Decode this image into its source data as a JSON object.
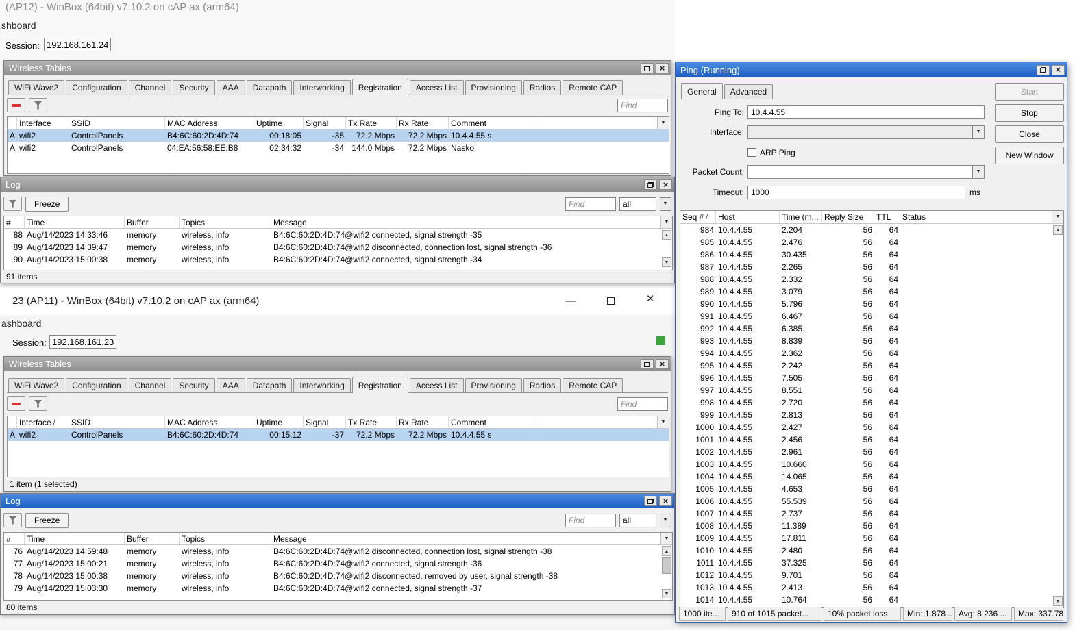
{
  "colors": {
    "titlebar_active": "#2e6fd0",
    "titlebar_inactive": "#9e9e9e",
    "selection": "#b7d3f0",
    "status_green": "#3aa53a",
    "remove_red": "#dd3333"
  },
  "shared": {
    "find_placeholder": "Find",
    "freeze_label": "Freeze",
    "filter_all": "all",
    "wt_title": "Wireless Tables",
    "log_title": "Log",
    "wt_tabs": [
      {
        "label": "WiFi Wave2"
      },
      {
        "label": "Configuration"
      },
      {
        "label": "Channel"
      },
      {
        "label": "Security"
      },
      {
        "label": "AAA"
      },
      {
        "label": "Datapath"
      },
      {
        "label": "Interworking"
      },
      {
        "label": "Registration",
        "sel": true
      },
      {
        "label": "Access List"
      },
      {
        "label": "Provisioning"
      },
      {
        "label": "Radios"
      },
      {
        "label": "Remote CAP"
      }
    ],
    "reg_columns": {
      "interface": "Interface",
      "ssid": "SSID",
      "mac": "MAC Address",
      "uptime": "Uptime",
      "signal": "Signal",
      "tx": "Tx Rate",
      "rx": "Rx Rate",
      "comment": "Comment"
    },
    "log_columns": {
      "num": "#",
      "time": "Time",
      "buffer": "Buffer",
      "topics": "Topics",
      "message": "Message"
    }
  },
  "ap12": {
    "window_title": "(AP12) - WinBox (64bit) v7.10.2 on cAP ax (arm64)",
    "dashboard_partial": "shboard",
    "session_label": "Session:",
    "session_value": "192.168.161.24",
    "reg_rows": [
      {
        "flag": "A",
        "iface": "wifi2",
        "ssid": "ControlPanels",
        "mac": "B4:6C:60:2D:4D:74",
        "uptime": "00:18:05",
        "signal": "-35",
        "tx": "72.2 Mbps",
        "rx": "72.2 Mbps",
        "comment": "10.4.4.55 s",
        "sel": true
      },
      {
        "flag": "A",
        "iface": "wifi2",
        "ssid": "ControlPanels",
        "mac": "04:EA:56:58:EE:B8",
        "uptime": "02:34:32",
        "signal": "-34",
        "tx": "144.0 Mbps",
        "rx": "72.2 Mbps",
        "comment": "Nasko"
      }
    ],
    "log_rows": [
      {
        "num": "88",
        "time": "Aug/14/2023 14:33:46",
        "buffer": "memory",
        "topics": "wireless, info",
        "message": "B4:6C:60:2D:4D:74@wifi2 connected, signal strength -35"
      },
      {
        "num": "89",
        "time": "Aug/14/2023 14:39:47",
        "buffer": "memory",
        "topics": "wireless, info",
        "message": "B4:6C:60:2D:4D:74@wifi2 disconnected, connection lost, signal strength -36"
      },
      {
        "num": "90",
        "time": "Aug/14/2023 15:00:38",
        "buffer": "memory",
        "topics": "wireless, info",
        "message": "B4:6C:60:2D:4D:74@wifi2 connected, signal strength -34"
      }
    ],
    "log_items_text": "91 items"
  },
  "ap11": {
    "window_title": "23 (AP11) - WinBox (64bit) v7.10.2 on cAP ax (arm64)",
    "dashboard_partial": "ashboard",
    "session_label": "Session:",
    "session_value": "192.168.161.23",
    "reg_rows": [
      {
        "flag": "A",
        "iface": "wifi2",
        "ssid": "ControlPanels",
        "mac": "B4:6C:60:2D:4D:74",
        "uptime": "00:15:12",
        "signal": "-37",
        "tx": "72.2 Mbps",
        "rx": "72.2 Mbps",
        "comment": "10.4.4.55 s",
        "sel": true
      }
    ],
    "reg_items_text": "1 item (1 selected)",
    "log_rows": [
      {
        "num": "76",
        "time": "Aug/14/2023 14:59:48",
        "buffer": "memory",
        "topics": "wireless, info",
        "message": "B4:6C:60:2D:4D:74@wifi2 disconnected, connection lost, signal strength -38"
      },
      {
        "num": "77",
        "time": "Aug/14/2023 15:00:21",
        "buffer": "memory",
        "topics": "wireless, info",
        "message": "B4:6C:60:2D:4D:74@wifi2 connected, signal strength -36"
      },
      {
        "num": "78",
        "time": "Aug/14/2023 15:00:38",
        "buffer": "memory",
        "topics": "wireless, info",
        "message": "B4:6C:60:2D:4D:74@wifi2 disconnected, removed by user, signal strength -38"
      },
      {
        "num": "79",
        "time": "Aug/14/2023 15:03:30",
        "buffer": "memory",
        "topics": "wireless, info",
        "message": "B4:6C:60:2D:4D:74@wifi2 connected, signal strength -37"
      }
    ],
    "log_items_text": "80 items"
  },
  "ping": {
    "window_title": "Ping (Running)",
    "tabs": [
      {
        "label": "General",
        "sel": true
      },
      {
        "label": "Advanced"
      }
    ],
    "buttons": {
      "start": "Start",
      "stop": "Stop",
      "close": "Close",
      "new_window": "New Window"
    },
    "form": {
      "ping_to_label": "Ping To:",
      "ping_to_value": "10.4.4.55",
      "interface_label": "Interface:",
      "arp_ping_label": "ARP Ping",
      "packet_count_label": "Packet Count:",
      "timeout_label": "Timeout:",
      "timeout_value": "1000",
      "timeout_unit": "ms"
    },
    "columns": {
      "seq": "Seq #",
      "host": "Host",
      "time": "Time (m...",
      "size": "Reply Size",
      "ttl": "TTL",
      "status": "Status"
    },
    "rows": [
      [
        "984",
        "10.4.4.55",
        "2.204",
        "56",
        "64"
      ],
      [
        "985",
        "10.4.4.55",
        "2.476",
        "56",
        "64"
      ],
      [
        "986",
        "10.4.4.55",
        "30.435",
        "56",
        "64"
      ],
      [
        "987",
        "10.4.4.55",
        "2.265",
        "56",
        "64"
      ],
      [
        "988",
        "10.4.4.55",
        "2.332",
        "56",
        "64"
      ],
      [
        "989",
        "10.4.4.55",
        "3.079",
        "56",
        "64"
      ],
      [
        "990",
        "10.4.4.55",
        "5.796",
        "56",
        "64"
      ],
      [
        "991",
        "10.4.4.55",
        "6.467",
        "56",
        "64"
      ],
      [
        "992",
        "10.4.4.55",
        "6.385",
        "56",
        "64"
      ],
      [
        "993",
        "10.4.4.55",
        "8.839",
        "56",
        "64"
      ],
      [
        "994",
        "10.4.4.55",
        "2.362",
        "56",
        "64"
      ],
      [
        "995",
        "10.4.4.55",
        "2.242",
        "56",
        "64"
      ],
      [
        "996",
        "10.4.4.55",
        "7.505",
        "56",
        "64"
      ],
      [
        "997",
        "10.4.4.55",
        "8.551",
        "56",
        "64"
      ],
      [
        "998",
        "10.4.4.55",
        "2.720",
        "56",
        "64"
      ],
      [
        "999",
        "10.4.4.55",
        "2.813",
        "56",
        "64"
      ],
      [
        "1000",
        "10.4.4.55",
        "2.427",
        "56",
        "64"
      ],
      [
        "1001",
        "10.4.4.55",
        "2.456",
        "56",
        "64"
      ],
      [
        "1002",
        "10.4.4.55",
        "2.961",
        "56",
        "64"
      ],
      [
        "1003",
        "10.4.4.55",
        "10.660",
        "56",
        "64"
      ],
      [
        "1004",
        "10.4.4.55",
        "14.065",
        "56",
        "64"
      ],
      [
        "1005",
        "10.4.4.55",
        "4.653",
        "56",
        "64"
      ],
      [
        "1006",
        "10.4.4.55",
        "55.539",
        "56",
        "64"
      ],
      [
        "1007",
        "10.4.4.55",
        "2.737",
        "56",
        "64"
      ],
      [
        "1008",
        "10.4.4.55",
        "11.389",
        "56",
        "64"
      ],
      [
        "1009",
        "10.4.4.55",
        "17.811",
        "56",
        "64"
      ],
      [
        "1010",
        "10.4.4.55",
        "2.480",
        "56",
        "64"
      ],
      [
        "1011",
        "10.4.4.55",
        "37.325",
        "56",
        "64"
      ],
      [
        "1012",
        "10.4.4.55",
        "9.701",
        "56",
        "64"
      ],
      [
        "1013",
        "10.4.4.55",
        "2.413",
        "56",
        "64"
      ],
      [
        "1014",
        "10.4.4.55",
        "10.764",
        "56",
        "64"
      ]
    ],
    "statusbar": [
      "1000 ite...",
      "910 of 1015 packet...",
      "10% packet loss",
      "Min: 1.878 ...",
      "Avg: 8.236 ...",
      "Max: 337.78..."
    ]
  }
}
